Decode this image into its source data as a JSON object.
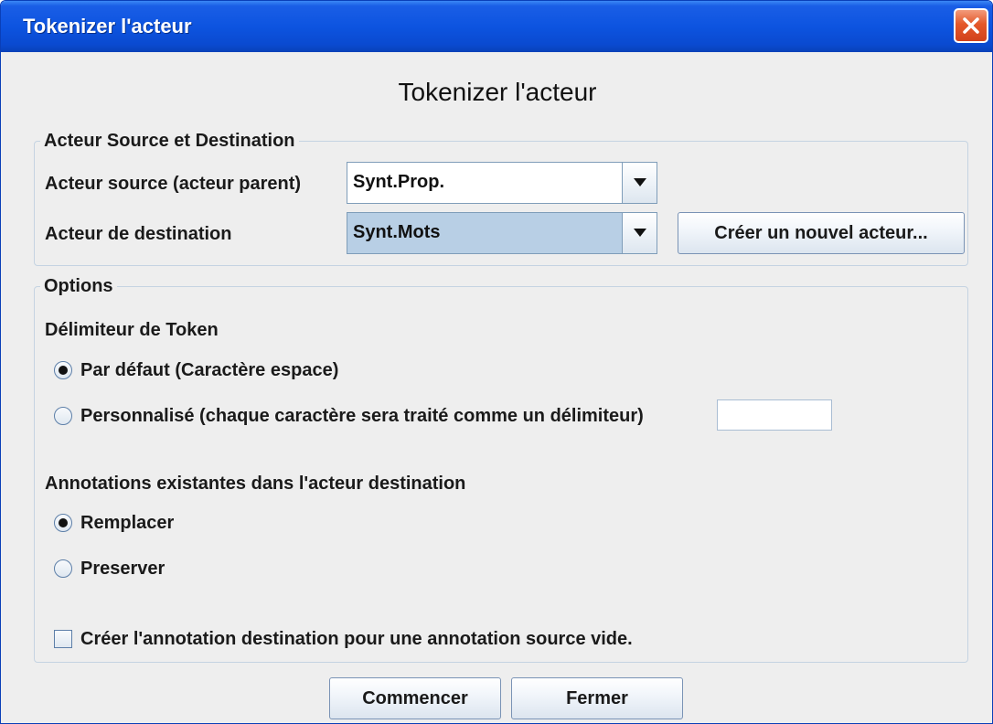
{
  "window": {
    "title": "Tokenizer l'acteur"
  },
  "heading": "Tokenizer l'acteur",
  "actors_group": {
    "legend": "Acteur Source et Destination",
    "source_label": "Acteur source (acteur parent)",
    "source_value": "Synt.Prop.",
    "destination_label": "Acteur de destination",
    "destination_value": "Synt.Mots",
    "create_button_label": "Créer un nouvel acteur..."
  },
  "options_group": {
    "legend": "Options",
    "delimiter_heading": "Délimiteur de Token",
    "delimiter_default_label": "Par défaut (Caractère espace)",
    "delimiter_default_selected": true,
    "delimiter_custom_label": "Personnalisé (chaque caractère sera traité comme un délimiteur)",
    "delimiter_custom_selected": false,
    "delimiter_custom_value": "",
    "annotations_heading": "Annotations existantes dans l'acteur destination",
    "replace_label": "Remplacer",
    "replace_selected": true,
    "preserve_label": "Preserver",
    "preserve_selected": false,
    "create_empty_label": "Créer l'annotation destination pour une annotation source vide.",
    "create_empty_checked": false
  },
  "footer": {
    "start_button_label": "Commencer",
    "close_button_label": "Fermer"
  },
  "icons": {
    "close": "close-icon",
    "dropdown": "chevron-down-icon"
  }
}
